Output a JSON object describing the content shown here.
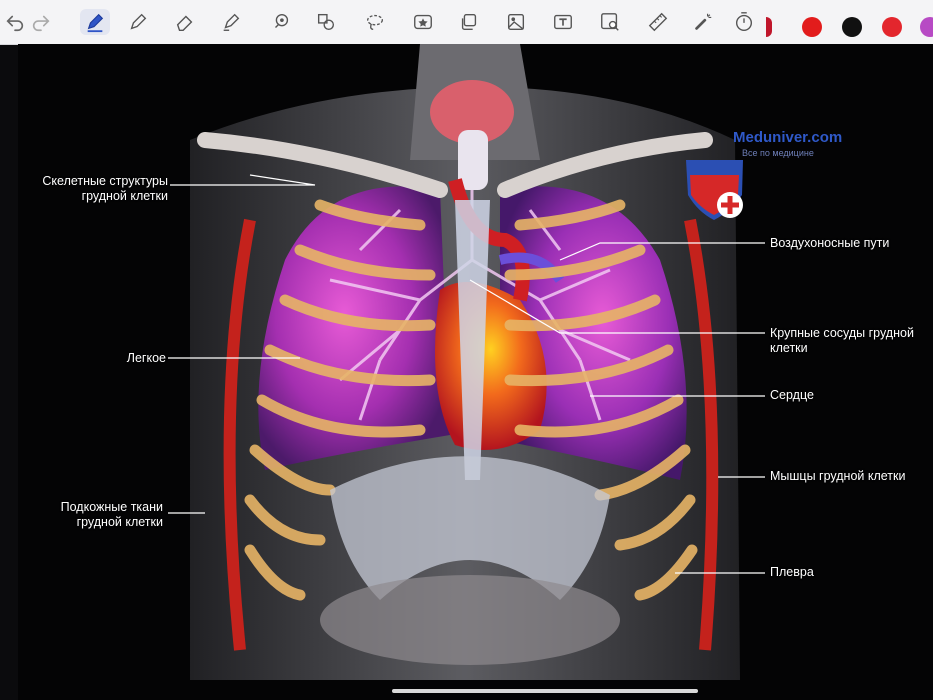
{
  "toolbar": {
    "tools": [
      "undo-icon",
      "redo-icon",
      "pen-icon",
      "pencil-icon",
      "eraser-icon",
      "highlighter-icon",
      "lasso-select-icon",
      "shapes-icon",
      "lasso-icon",
      "sticker-icon",
      "copy-icon",
      "image-icon",
      "text-icon",
      "image-search-icon",
      "ruler-icon",
      "laser-pointer-icon",
      "timer-icon"
    ],
    "colors": [
      "#c0162b",
      "#e21c1c",
      "#111111",
      "#e3262d",
      "#b74ac4"
    ]
  },
  "watermark": {
    "site": "Meduniver.com",
    "tagline": "Все по медицине"
  },
  "labels": {
    "skeletal": [
      "Скелетные структуры",
      "грудной клетки"
    ],
    "lung": "Легкое",
    "subcutaneous": [
      "Подкожные ткани",
      "грудной клетки"
    ],
    "airways": "Воздухоносные пути",
    "vessels": [
      "Крупные сосуды грудной",
      "клетки"
    ],
    "heart": "Сердце",
    "muscles": "Мышцы грудной клетки",
    "pleura": "Плевра"
  }
}
